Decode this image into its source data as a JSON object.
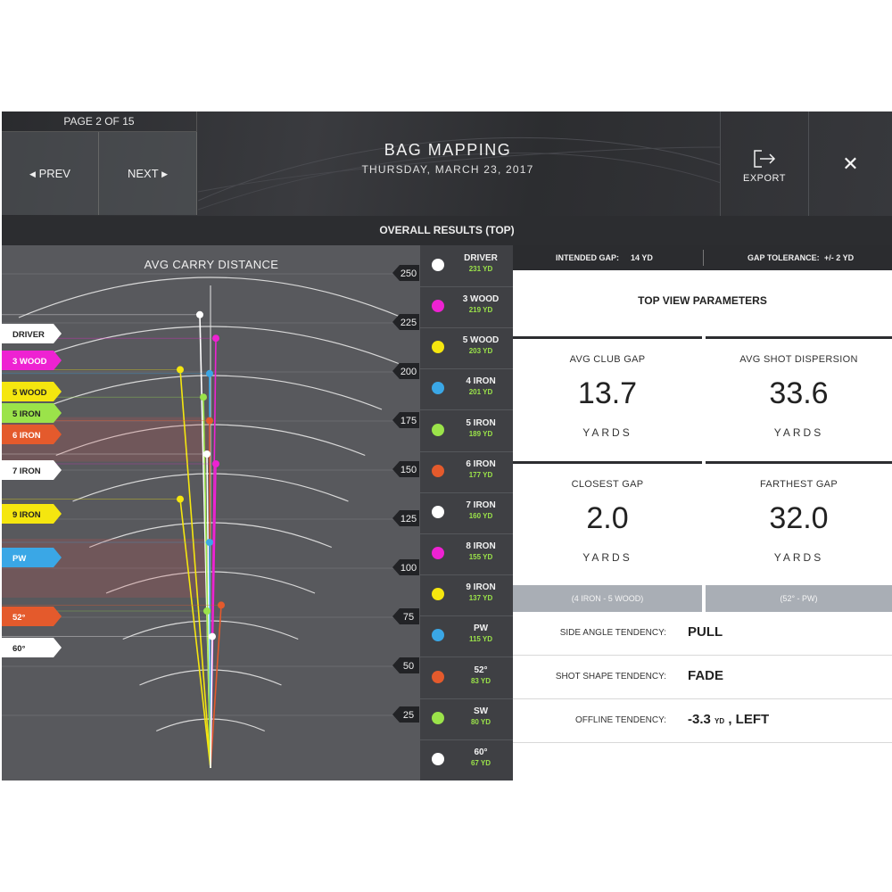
{
  "header": {
    "page_indicator": "PAGE 2 OF 15",
    "prev_label": "PREV",
    "next_label": "NEXT",
    "title": "BAG MAPPING",
    "date": "THURSDAY, MARCH 23, 2017",
    "export_label": "EXPORT",
    "close_symbol": "✕"
  },
  "banner": "OVERALL RESULTS (TOP)",
  "chart": {
    "title": "AVG CARRY DISTANCE",
    "distance_ticks": [
      "250",
      "225",
      "200",
      "175",
      "150",
      "125",
      "100",
      "75",
      "50",
      "25"
    ],
    "flags": [
      {
        "label": "DRIVER",
        "color": "#ffffff",
        "text": "#222222"
      },
      {
        "label": "3 WOOD",
        "color": "#ee22d2",
        "text": "#ffffff"
      },
      {
        "label": "5 WOOD",
        "color": "#f5e60f",
        "text": "#222222"
      },
      {
        "label": "5 IRON",
        "color": "#9be34a",
        "text": "#222222"
      },
      {
        "label": "6 IRON",
        "color": "#e45a2c",
        "text": "#ffffff"
      },
      {
        "label": "7 IRON",
        "color": "#ffffff",
        "text": "#222222"
      },
      {
        "label": "9 IRON",
        "color": "#f5e60f",
        "text": "#222222"
      },
      {
        "label": "PW",
        "color": "#3aa7e6",
        "text": "#ffffff"
      },
      {
        "label": "52°",
        "color": "#e45a2c",
        "text": "#ffffff"
      },
      {
        "label": "60°",
        "color": "#ffffff",
        "text": "#222222"
      }
    ]
  },
  "clubs": [
    {
      "name": "DRIVER",
      "dist": "231 YD",
      "color": "#ffffff"
    },
    {
      "name": "3 WOOD",
      "dist": "219 YD",
      "color": "#ee22d2"
    },
    {
      "name": "5 WOOD",
      "dist": "203 YD",
      "color": "#f5e60f"
    },
    {
      "name": "4 IRON",
      "dist": "201 YD",
      "color": "#3aa7e6"
    },
    {
      "name": "5 IRON",
      "dist": "189 YD",
      "color": "#9be34a"
    },
    {
      "name": "6 IRON",
      "dist": "177 YD",
      "color": "#e45a2c"
    },
    {
      "name": "7 IRON",
      "dist": "160 YD",
      "color": "#ffffff"
    },
    {
      "name": "8 IRON",
      "dist": "155 YD",
      "color": "#ee22d2"
    },
    {
      "name": "9 IRON",
      "dist": "137 YD",
      "color": "#f5e60f"
    },
    {
      "name": "PW",
      "dist": "115 YD",
      "color": "#3aa7e6"
    },
    {
      "name": "52°",
      "dist": "83 YD",
      "color": "#e45a2c"
    },
    {
      "name": "SW",
      "dist": "80 YD",
      "color": "#9be34a"
    },
    {
      "name": "60°",
      "dist": "67 YD",
      "color": "#ffffff"
    }
  ],
  "params": {
    "intended_gap_label": "INTENDED GAP:",
    "intended_gap_value": "14 YD",
    "gap_tolerance_label": "GAP TOLERANCE:",
    "gap_tolerance_value": "+/- 2 YD",
    "section_title": "TOP VIEW PARAMETERS",
    "avg_club_gap": {
      "label": "AVG CLUB GAP",
      "value": "13.7",
      "unit": "YARDS"
    },
    "avg_shot_dispersion": {
      "label": "AVG SHOT DISPERSION",
      "value": "33.6",
      "unit": "YARDS"
    },
    "closest_gap": {
      "label": "CLOSEST GAP",
      "value": "2.0",
      "unit": "YARDS",
      "note": "(4 IRON - 5 WOOD)"
    },
    "farthest_gap": {
      "label": "FARTHEST GAP",
      "value": "32.0",
      "unit": "YARDS",
      "note": "(52° - PW)"
    },
    "side_angle": {
      "label": "SIDE ANGLE TENDENCY:",
      "value": "PULL"
    },
    "shot_shape": {
      "label": "SHOT SHAPE TENDENCY:",
      "value": "FADE"
    },
    "offline": {
      "label": "OFFLINE TENDENCY:",
      "value": "-3.3",
      "unit": "YD",
      "direction": ", LEFT"
    }
  }
}
